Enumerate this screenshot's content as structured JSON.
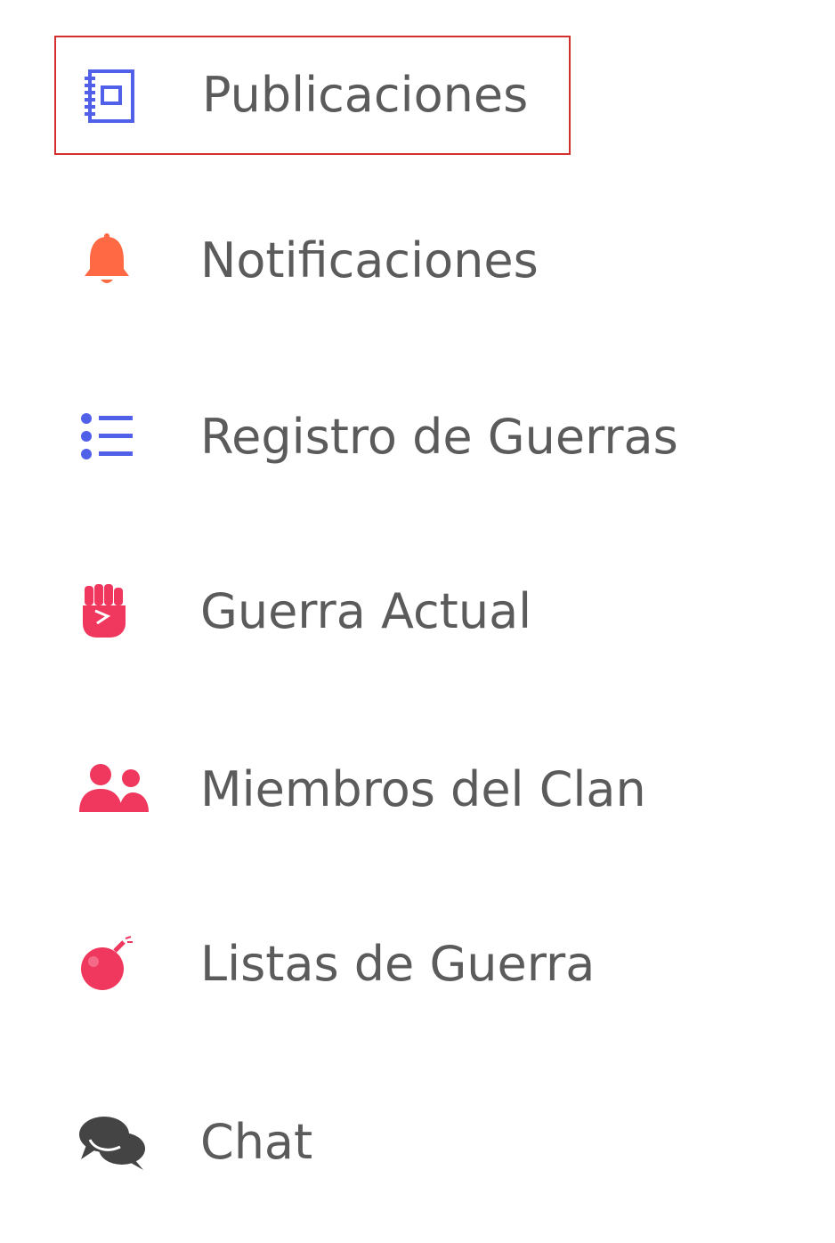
{
  "sidebar": {
    "selected_index": 0,
    "items": [
      {
        "label": "Publicaciones",
        "icon": "notebook-icon",
        "icon_color": "#5060e8"
      },
      {
        "label": "Notificaciones",
        "icon": "bell-icon",
        "icon_color": "#ff6a44"
      },
      {
        "label": "Registro de Guerras",
        "icon": "list-icon",
        "icon_color": "#5060e8"
      },
      {
        "label": "Guerra Actual",
        "icon": "fist-icon",
        "icon_color": "#f0385f"
      },
      {
        "label": "Miembros del Clan",
        "icon": "users-icon",
        "icon_color": "#f0385f"
      },
      {
        "label": "Listas de Guerra",
        "icon": "bomb-icon",
        "icon_color": "#f0385f"
      },
      {
        "label": "Chat",
        "icon": "comments-icon",
        "icon_color": "#444444"
      }
    ]
  }
}
